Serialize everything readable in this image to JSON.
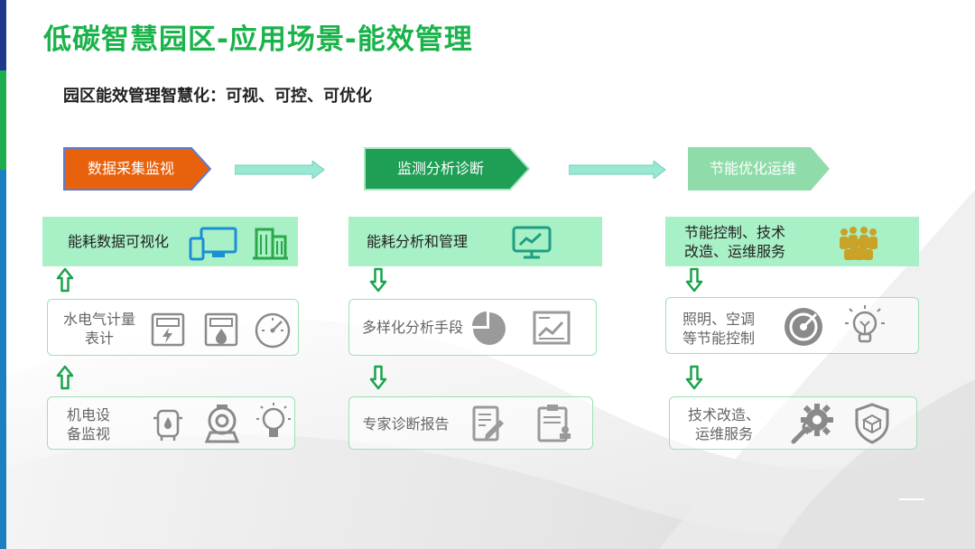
{
  "title": "低碳智慧园区-应用场景-能效管理",
  "subtitle": "园区能效管理智慧化：可视、可控、可优化",
  "colors": {
    "title_green": "#19b34a",
    "stage1_fill": "#e8620d",
    "stage2_fill": "#1f9e55",
    "stage3_fill": "#8fdcaa",
    "head_box_fill": "#a8f0c6",
    "item_box_border": "#9de0b6",
    "arrow_green": "#19a34a",
    "left_bar_top": "#1f3a8a",
    "left_bar_mid": "#1fae4f",
    "left_bar_bottom": "#1b7fc0"
  },
  "columns": [
    {
      "stage_label": "数据采集监视",
      "header": {
        "line1": "能耗数据可视化",
        "line2": "",
        "icons": [
          "devices-icon",
          "building-icon"
        ]
      },
      "connector_direction": "up",
      "items": [
        {
          "line1": "水电气计量",
          "line2": "表计",
          "icons": [
            "electric-meter-icon",
            "gas-meter-icon",
            "gauge-icon"
          ]
        },
        {
          "line1": "机电设",
          "line2": "备监视",
          "icons": [
            "boiler-icon",
            "pump-icon",
            "bulb-icon"
          ]
        }
      ]
    },
    {
      "stage_label": "监测分析诊断",
      "header": {
        "line1": "能耗分析和管理",
        "line2": "",
        "icons": [
          "monitor-chart-icon"
        ]
      },
      "connector_direction": "down",
      "items": [
        {
          "line1": "多样化分析手段",
          "line2": "",
          "icons": [
            "pie-chart-icon",
            "line-chart-icon"
          ]
        },
        {
          "line1": "专家诊断报告",
          "line2": "",
          "icons": [
            "report-edit-icon",
            "report-stamp-icon"
          ]
        }
      ]
    },
    {
      "stage_label": "节能优化运维",
      "header": {
        "line1": "节能控制、技术",
        "line2": "改造、运维服务",
        "icons": [
          "team-icon"
        ]
      },
      "connector_direction": "down",
      "items": [
        {
          "line1": "照明、空调",
          "line2": "等节能控制",
          "icons": [
            "target-icon",
            "lightbulb-icon"
          ]
        },
        {
          "line1": "技术改造、",
          "line2": "运维服务",
          "icons": [
            "gear-wrench-icon",
            "shield-box-icon"
          ]
        }
      ]
    }
  ]
}
